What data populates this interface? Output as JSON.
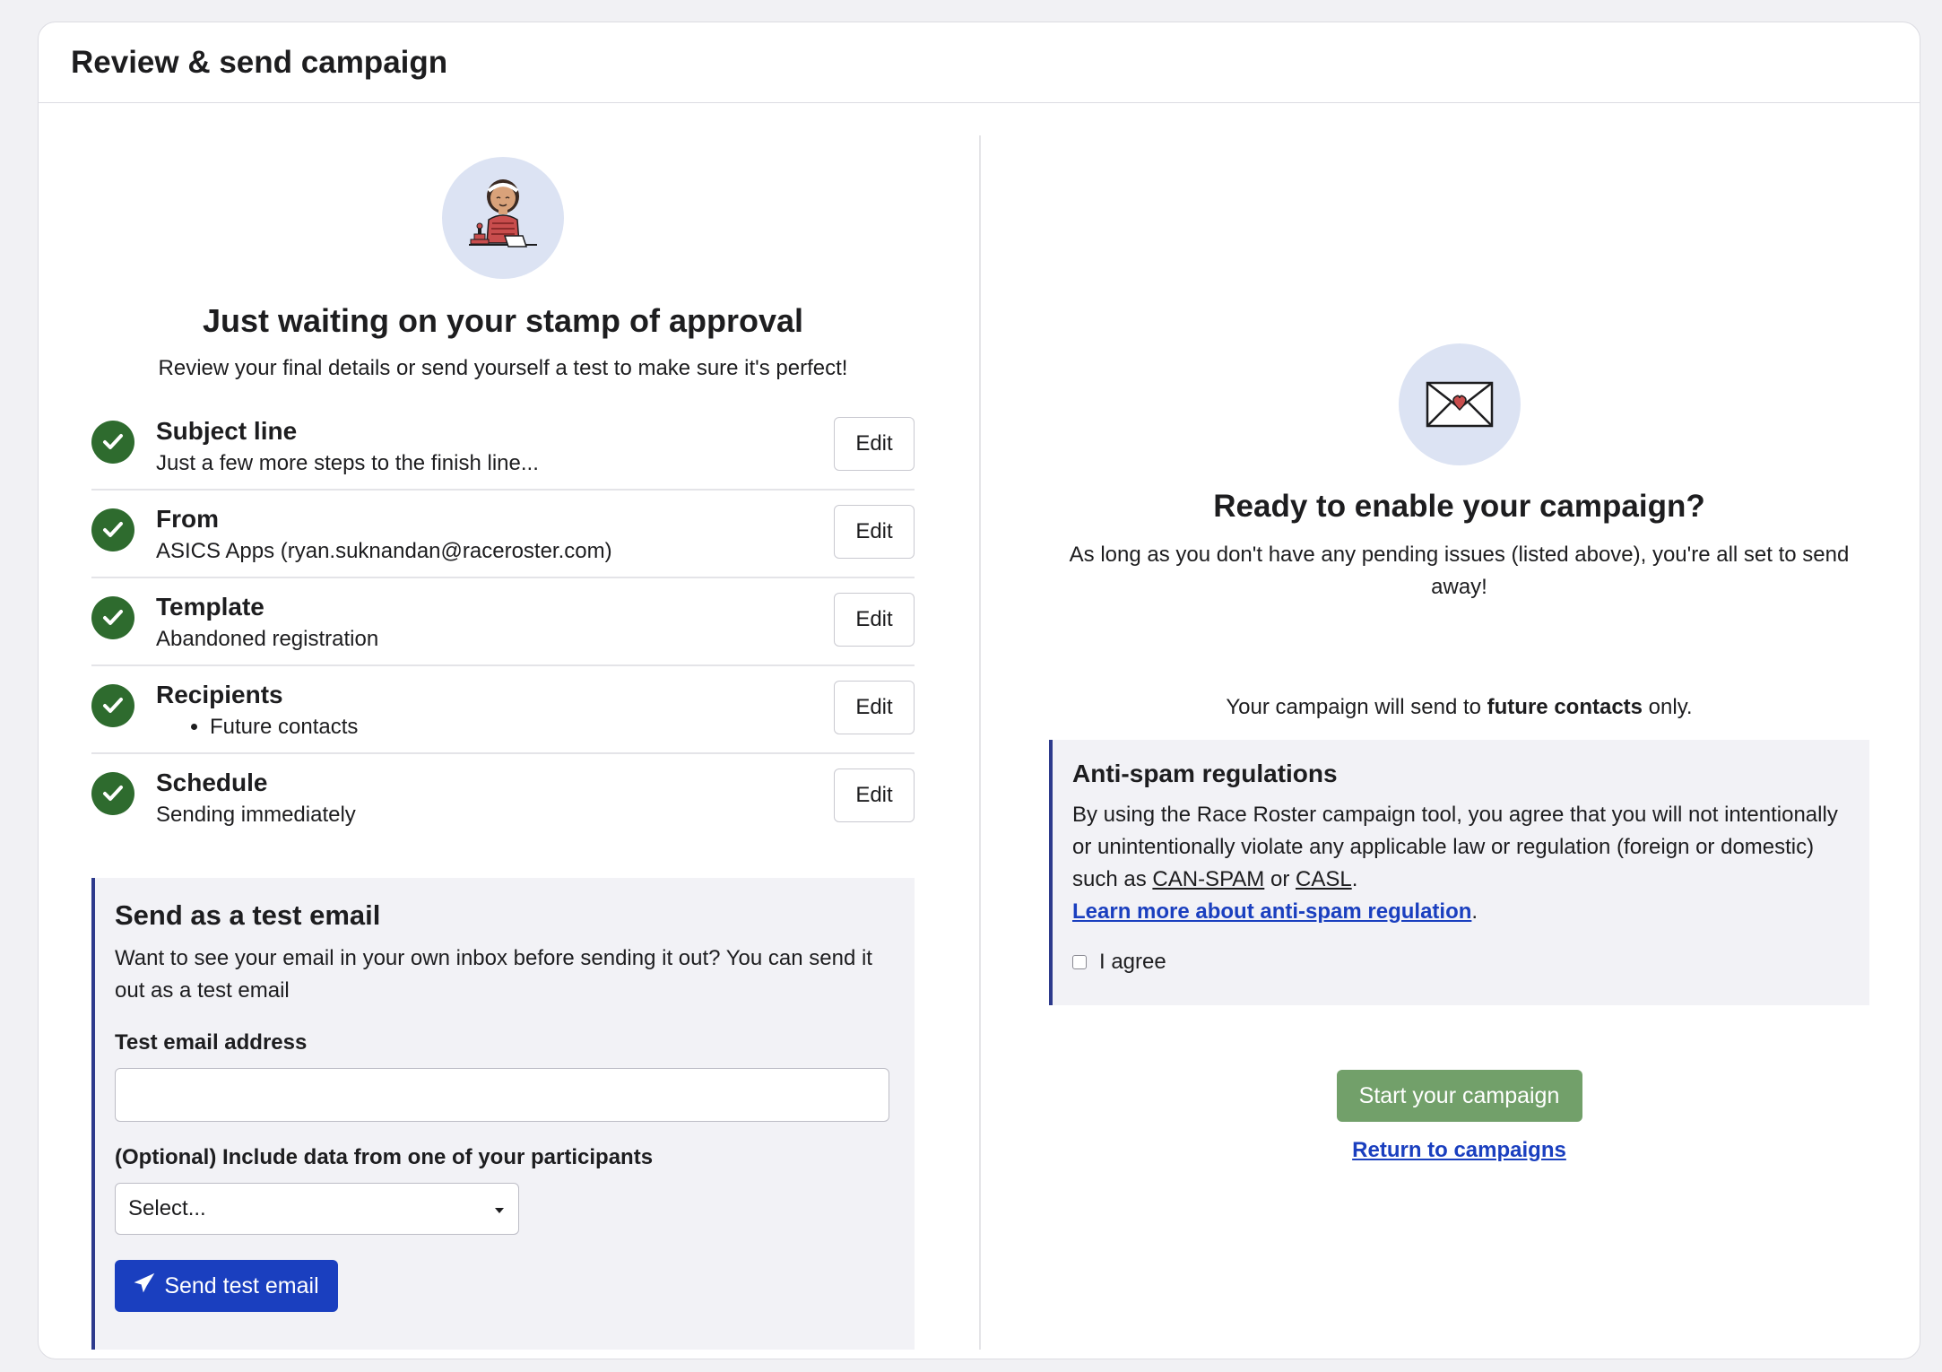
{
  "header": {
    "title": "Review & send campaign"
  },
  "left": {
    "hero_title": "Just waiting on your stamp of approval",
    "hero_subtitle": "Review your final details or send yourself a test to make sure it's perfect!",
    "edit_label": "Edit",
    "checklist": [
      {
        "label": "Subject line",
        "value": "Just a few more steps to the finish line..."
      },
      {
        "label": "From",
        "value": "ASICS Apps (ryan.suknandan@raceroster.com)"
      },
      {
        "label": "Template",
        "value": "Abandoned registration"
      },
      {
        "label": "Recipients",
        "value": "Future contacts"
      },
      {
        "label": "Schedule",
        "value": "Sending immediately"
      }
    ],
    "test_box": {
      "title": "Send as a test email",
      "description": "Want to see your email in your own inbox before sending it out? You can send it out as a test email",
      "email_label": "Test email address",
      "email_value": "",
      "participant_label": "(Optional) Include data from one of your participants",
      "participant_select": "Select...",
      "send_button": "Send test email"
    }
  },
  "right": {
    "ready_title": "Ready to enable your campaign?",
    "ready_subtitle": "As long as you don't have any pending issues (listed above), you're all set to send away!",
    "send_to_prefix": "Your campaign will send to ",
    "send_to_bold": "future contacts",
    "send_to_suffix": " only.",
    "spam": {
      "title": "Anti-spam regulations",
      "para_start": "By using the Race Roster campaign tool, you agree that you will not intentionally or unintentionally violate any applicable law or regulation (foreign or domestic) such as ",
      "can_spam": "CAN-SPAM",
      "or": " or ",
      "casl": "CASL",
      "period": ".",
      "learn_more": "Learn more about anti-spam regulation",
      "agree_label": "I agree"
    },
    "start_button": "Start your campaign",
    "return_link": "Return to campaigns"
  },
  "colors": {
    "primary": "#1a3fbf",
    "success": "#2e6b2e",
    "start_button": "#72a06a",
    "accent_border": "#2d3a8c"
  }
}
